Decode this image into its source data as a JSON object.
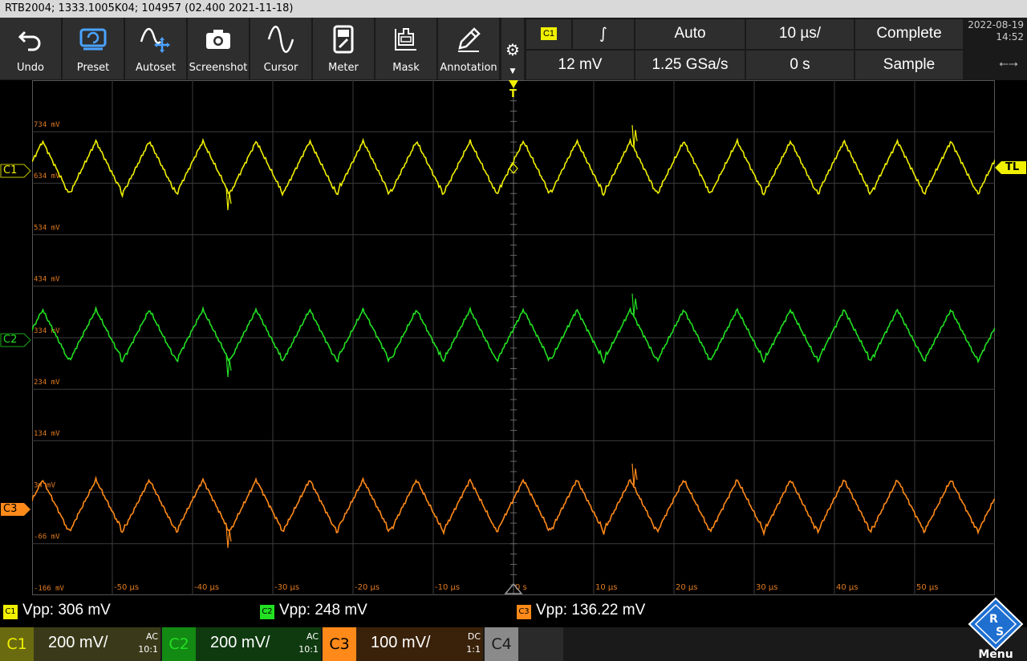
{
  "title_bar": "RTB2004; 1333.1005K04; 104957 (02.400 2021-11-18)",
  "toolbar": {
    "undo": "Undo",
    "preset": "Preset",
    "autoset": "Autoset",
    "screenshot": "Screenshot",
    "cursor": "Cursor",
    "meter": "Meter",
    "mask": "Mask",
    "annotation": "Annotation"
  },
  "status": {
    "trigger_source": "C1",
    "trigger_mode": "Auto",
    "timebase": "10 µs/",
    "acq_state": "Complete",
    "trigger_level": "12 mV",
    "sample_rate": "1.25 GSa/s",
    "position": "0 s",
    "acq_mode": "Sample",
    "date": "2022-08-19",
    "time": "14:52"
  },
  "grid": {
    "y_labels": [
      "734 mV",
      "634 mV",
      "534 mV",
      "434 mV",
      "334 mV",
      "234 mV",
      "134 mV",
      "34 mV",
      "-66 mV",
      "-166 mV"
    ],
    "x_labels": [
      "-50 µs",
      "-40 µs",
      "-30 µs",
      "-20 µs",
      "-10 µs",
      "0 s",
      "10 µs",
      "20 µs",
      "30 µs",
      "40 µs",
      "50 µs"
    ],
    "trigger_marker": "T",
    "trigger_level_tag": "TL"
  },
  "channels": [
    {
      "tag": "C1",
      "color": "#f0f000",
      "vpp_label": "Vpp: 306 mV",
      "scale": "200 mV/",
      "coupling": "AC",
      "probe": "10:1"
    },
    {
      "tag": "C2",
      "color": "#22e022",
      "vpp_label": "Vpp: 248 mV",
      "scale": "200 mV/",
      "coupling": "AC",
      "probe": "10:1"
    },
    {
      "tag": "C3",
      "color": "#ff8a1a",
      "vpp_label": "Vpp: 136.22 mV",
      "scale": "100 mV/",
      "coupling": "DC",
      "probe": "1:1"
    },
    {
      "tag": "C4",
      "color": "#8a8a8a",
      "vpp_label": "",
      "scale": "",
      "coupling": "",
      "probe": ""
    }
  ],
  "menu_label": "Menu"
}
